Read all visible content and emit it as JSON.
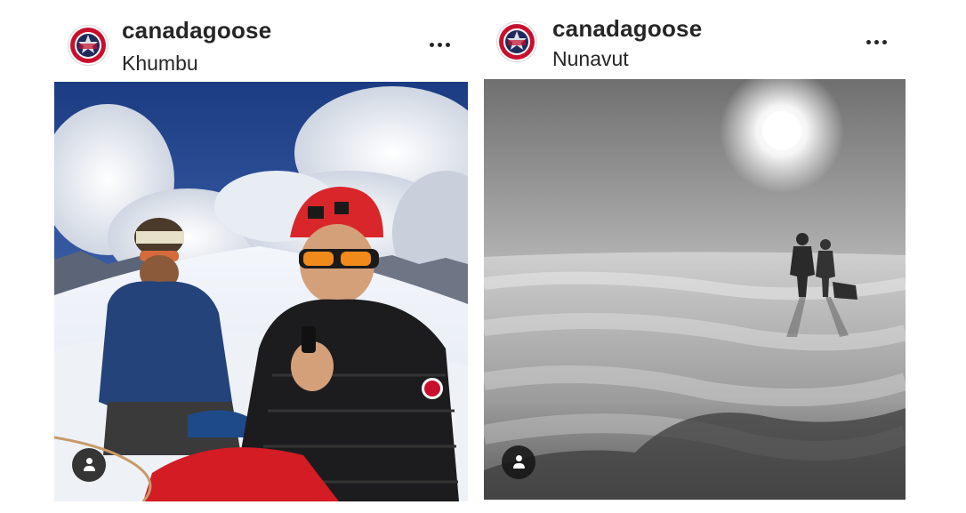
{
  "posts": [
    {
      "username": "canadagoose",
      "location": "Khumbu",
      "more_icon": "more-horizontal-icon",
      "avatar_icon": "canada-goose-logo-icon",
      "photo_desc_icon": "user-tag-icon",
      "colors": {
        "accent": "#c8102e",
        "brand_navy": "#1f2a5a",
        "text": "#262626"
      }
    },
    {
      "username": "canadagoose",
      "location": "Nunavut",
      "more_icon": "more-horizontal-icon",
      "avatar_icon": "canada-goose-logo-icon",
      "photo_desc_icon": "user-tag-icon",
      "colors": {
        "accent": "#c8102e",
        "brand_navy": "#1f2a5a",
        "text": "#262626"
      }
    }
  ]
}
